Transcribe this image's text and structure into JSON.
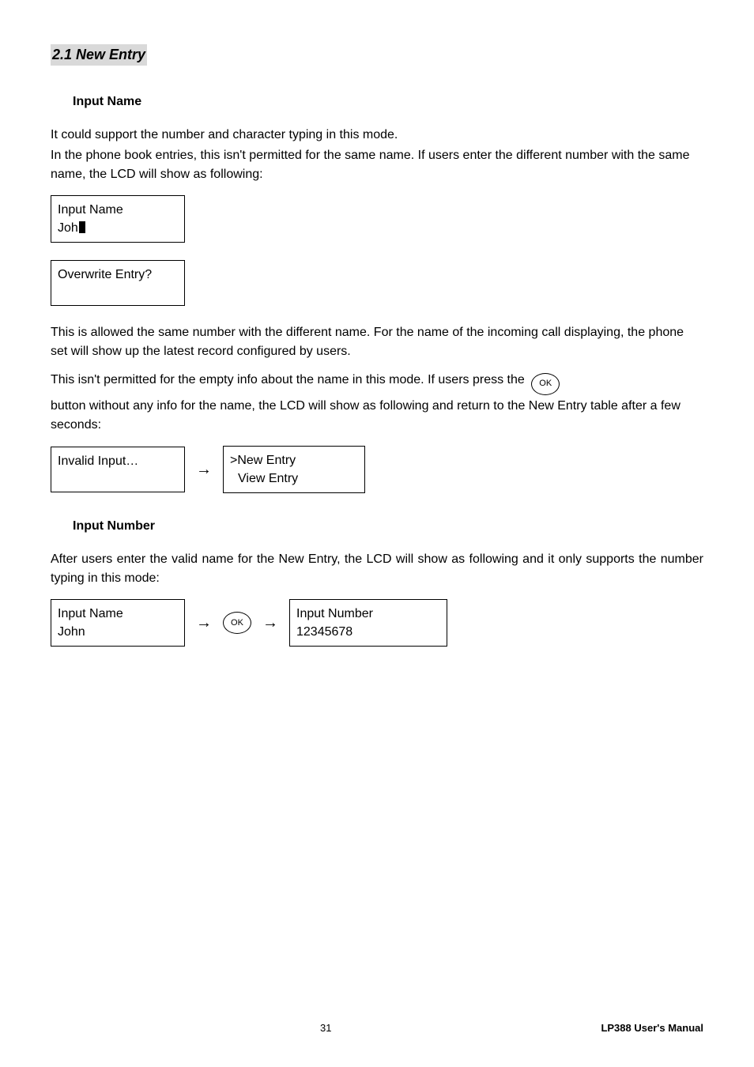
{
  "section_title": "2.1 New Entry",
  "input_name": {
    "heading": "Input Name",
    "para1": "It could support the number and character typing in this mode.",
    "para2": "In the phone book entries, this isn't permitted for the same name. If users enter the different number with the same name, the LCD will show as following:",
    "lcd_input_label": "Input Name",
    "lcd_input_value": "Joh",
    "lcd_overwrite": "Overwrite Entry?",
    "para3": "This is allowed the same number with the different name. For the name of the incoming call displaying, the phone set will show up the latest record configured by users.",
    "para4_pre": "This isn't permitted for the empty info about the name in this mode. If users press the",
    "para5": "button without any info for the name, the LCD will show as following and return to the New Entry table after a few seconds:",
    "lcd_invalid": "Invalid Input…",
    "lcd_menu_line1": ">New Entry",
    "lcd_menu_line2": "View Entry"
  },
  "input_number": {
    "heading": "Input Number",
    "para1": "After users enter the valid name for the New Entry, the LCD will show as following and it only supports the number typing in this mode:",
    "lcd_left_label": "Input Name",
    "lcd_left_value": "John",
    "lcd_right_label": "Input Number",
    "lcd_right_value": "12345678"
  },
  "buttons": {
    "ok": "OK"
  },
  "symbols": {
    "arrow": "→"
  },
  "footer": {
    "page": "31",
    "manual": "LP388  User's  Manual"
  }
}
